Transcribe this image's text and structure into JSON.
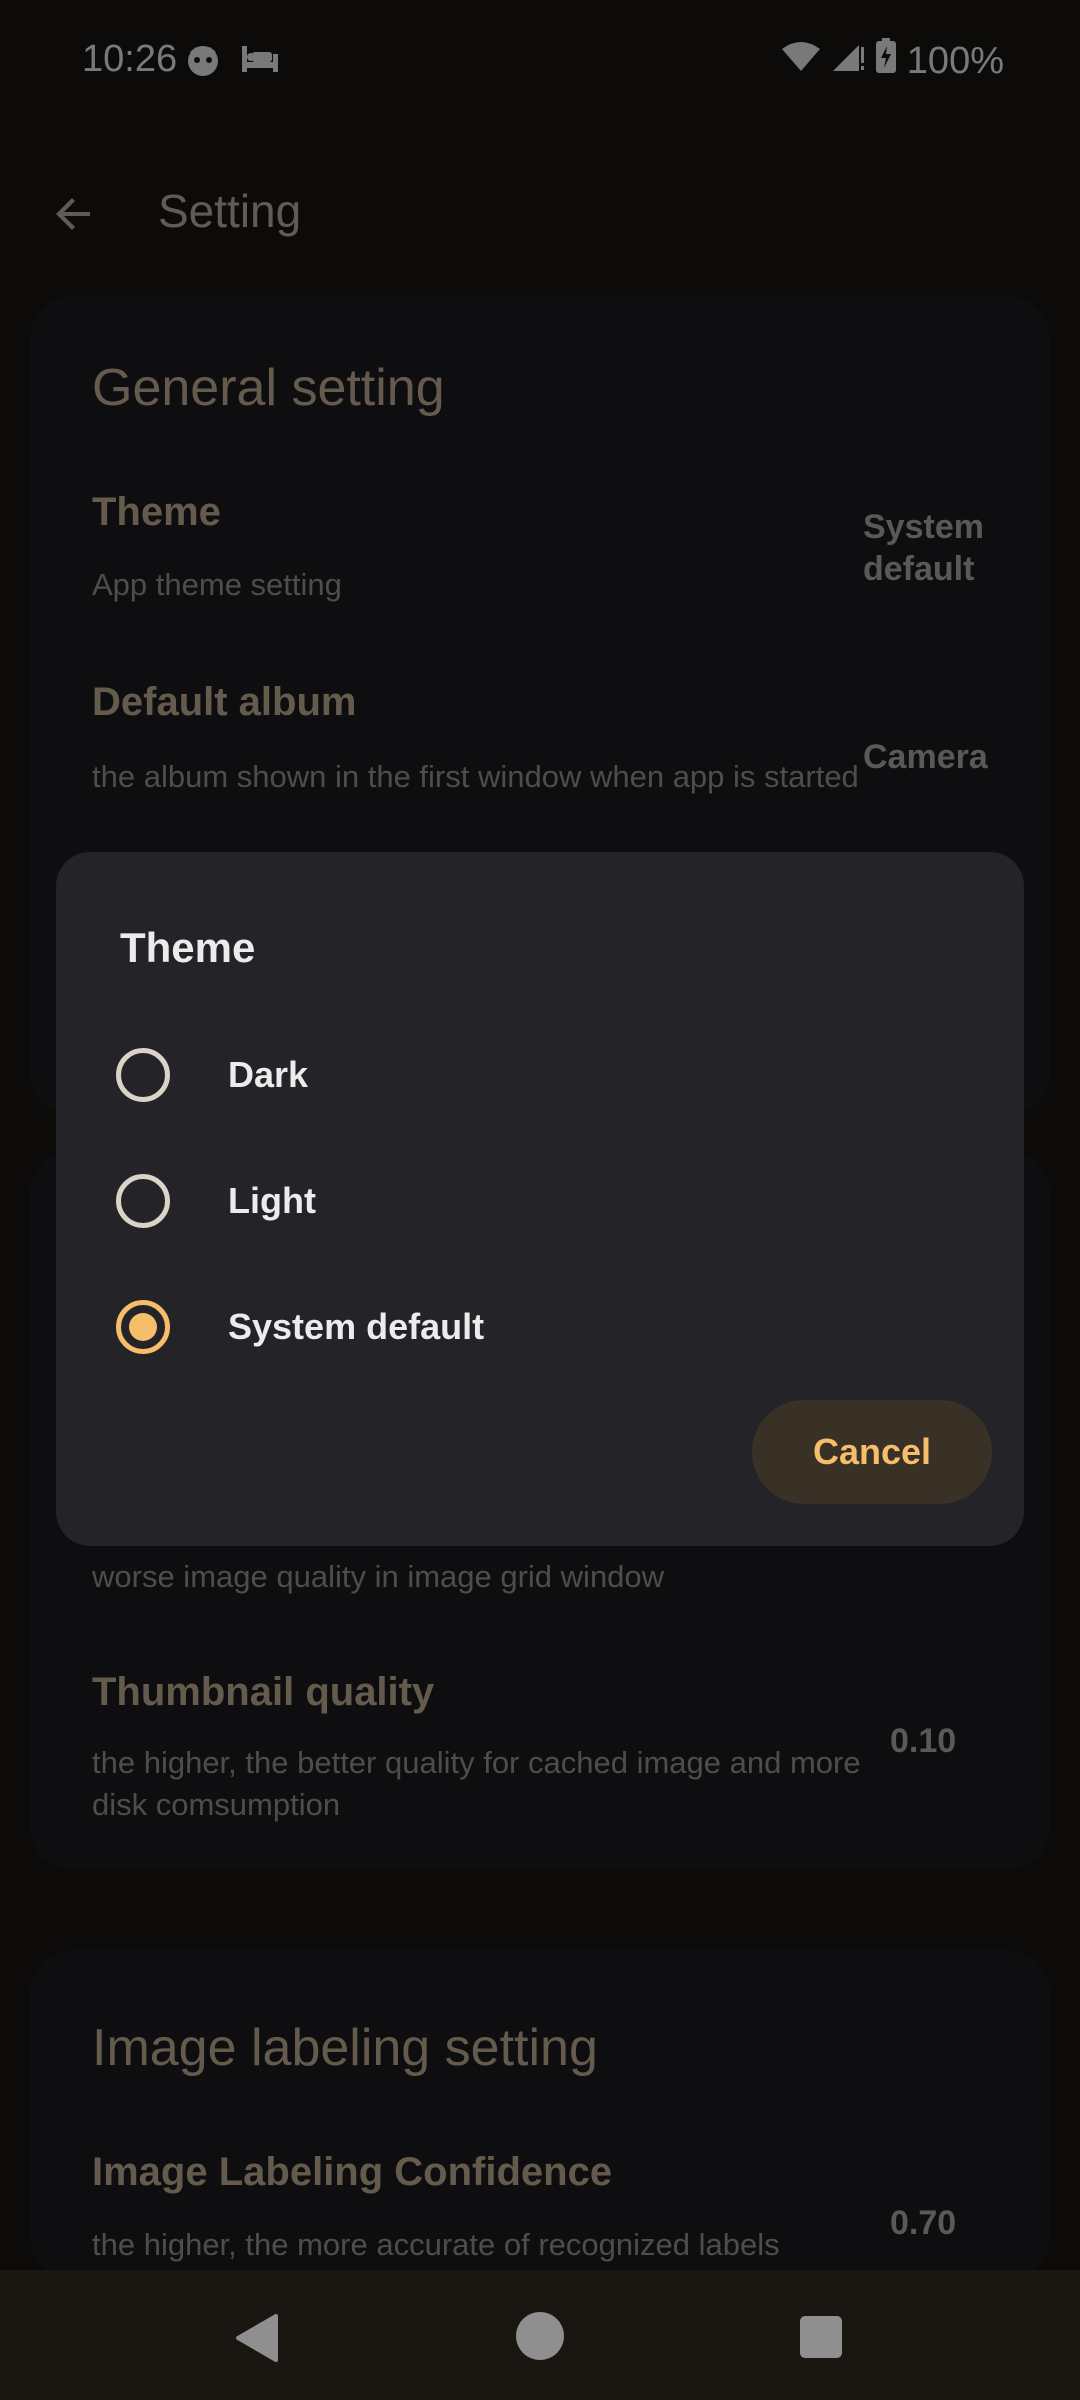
{
  "status_bar": {
    "time": "10:26",
    "battery": "100%",
    "icons": [
      "notification-face-icon",
      "sleep-bed-icon",
      "wifi-icon",
      "signal-icon",
      "battery-charging-icon"
    ]
  },
  "app_bar": {
    "title": "Setting",
    "back_icon": "arrow-back-icon"
  },
  "general_card": {
    "title": "General setting",
    "items": [
      {
        "title": "Theme",
        "description": "App theme setting",
        "value": "System default"
      },
      {
        "title": "Default album",
        "description": "the album shown in the first window when app is started",
        "value": "Camera"
      }
    ]
  },
  "performance_card": {
    "items": [
      {
        "description_tail": "worse image quality in image grid window"
      },
      {
        "title": "Thumbnail quality",
        "description": "the higher, the better quality for cached image and more disk comsumption",
        "value": "0.10"
      }
    ]
  },
  "labeling_card": {
    "title": "Image labeling setting",
    "items": [
      {
        "title": "Image Labeling Confidence",
        "description": "the higher, the more accurate of recognized labels",
        "value": "0.70"
      }
    ]
  },
  "dialog": {
    "title": "Theme",
    "options": [
      {
        "label": "Dark",
        "selected": false
      },
      {
        "label": "Light",
        "selected": false
      },
      {
        "label": "System default",
        "selected": true
      }
    ],
    "cancel_label": "Cancel"
  },
  "colors": {
    "accent": "#f6bd6a",
    "dialog_bg": "#232328",
    "background": "#1a1712"
  },
  "nav_bar": {
    "icons": [
      "nav-back-icon",
      "nav-home-icon",
      "nav-recents-icon"
    ]
  }
}
